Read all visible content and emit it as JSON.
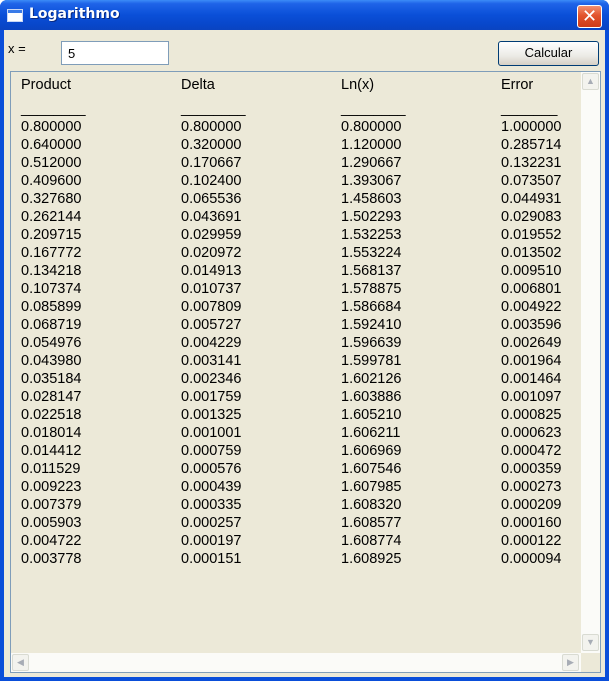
{
  "window": {
    "title": "Logarithmo",
    "close_glyph": "✕"
  },
  "form": {
    "x_label": "x =",
    "x_value": "5",
    "calc_label": "Calcular"
  },
  "table": {
    "columns": [
      {
        "header": "Product",
        "underline": "________",
        "values": [
          "0.800000",
          "0.640000",
          "0.512000",
          "0.409600",
          "0.327680",
          "0.262144",
          "0.209715",
          "0.167772",
          "0.134218",
          "0.107374",
          "0.085899",
          "0.068719",
          "0.054976",
          "0.043980",
          "0.035184",
          "0.028147",
          "0.022518",
          "0.018014",
          "0.014412",
          "0.011529",
          "0.009223",
          "0.007379",
          "0.005903",
          "0.004722",
          "0.003778"
        ]
      },
      {
        "header": "Delta",
        "underline": "________",
        "values": [
          "0.800000",
          "0.320000",
          "0.170667",
          "0.102400",
          "0.065536",
          "0.043691",
          "0.029959",
          "0.020972",
          "0.014913",
          "0.010737",
          "0.007809",
          "0.005727",
          "0.004229",
          "0.003141",
          "0.002346",
          "0.001759",
          "0.001325",
          "0.001001",
          "0.000759",
          "0.000576",
          "0.000439",
          "0.000335",
          "0.000257",
          "0.000197",
          "0.000151"
        ]
      },
      {
        "header": "Ln(x)",
        "underline": "________",
        "values": [
          "0.800000",
          "1.120000",
          "1.290667",
          "1.393067",
          "1.458603",
          "1.502293",
          "1.532253",
          "1.553224",
          "1.568137",
          "1.578875",
          "1.586684",
          "1.592410",
          "1.596639",
          "1.599781",
          "1.602126",
          "1.603886",
          "1.605210",
          "1.606211",
          "1.606969",
          "1.607546",
          "1.607985",
          "1.608320",
          "1.608577",
          "1.608774",
          "1.608925"
        ]
      },
      {
        "header": "Error",
        "underline": "_______",
        "values": [
          "1.000000",
          "0.285714",
          "0.132231",
          "0.073507",
          "0.044931",
          "0.029083",
          "0.019552",
          "0.013502",
          "0.009510",
          "0.006801",
          "0.004922",
          "0.003596",
          "0.002649",
          "0.001964",
          "0.001464",
          "0.001097",
          "0.000825",
          "0.000623",
          "0.000472",
          "0.000359",
          "0.000273",
          "0.000209",
          "0.000160",
          "0.000122",
          "0.000094"
        ]
      }
    ]
  },
  "scrollbar": {
    "up_glyph": "▲",
    "down_glyph": "▼",
    "left_glyph": "◀",
    "right_glyph": "▶"
  },
  "colors": {
    "titlebar": "#0a4fd8",
    "client_bg": "#ece9d8",
    "close_button": "#e2542d"
  }
}
